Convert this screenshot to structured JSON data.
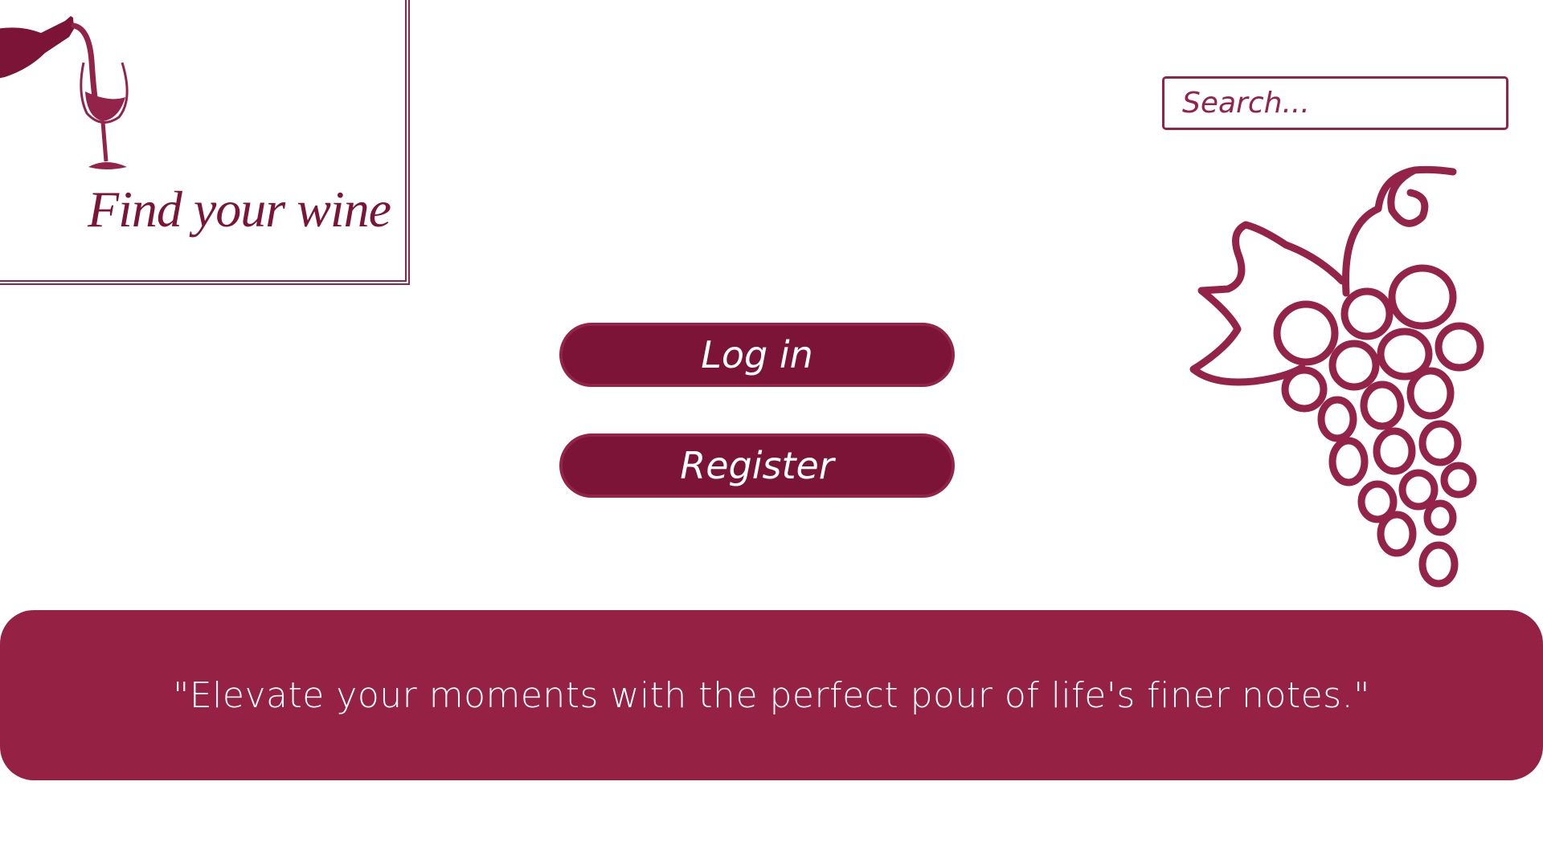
{
  "brand": {
    "logo_text": "Find your wine",
    "logo_icon": "wine-pour-icon"
  },
  "search": {
    "placeholder": "Search..."
  },
  "auth": {
    "login_label": "Log in",
    "register_label": "Register"
  },
  "decor": {
    "grapes_icon": "grapes-icon"
  },
  "banner": {
    "quote": "\"Elevate your moments with the perfect pour of life's finer notes.\""
  },
  "colors": {
    "primary": "#7b1436",
    "accent": "#952245",
    "background": "#ffffff"
  }
}
